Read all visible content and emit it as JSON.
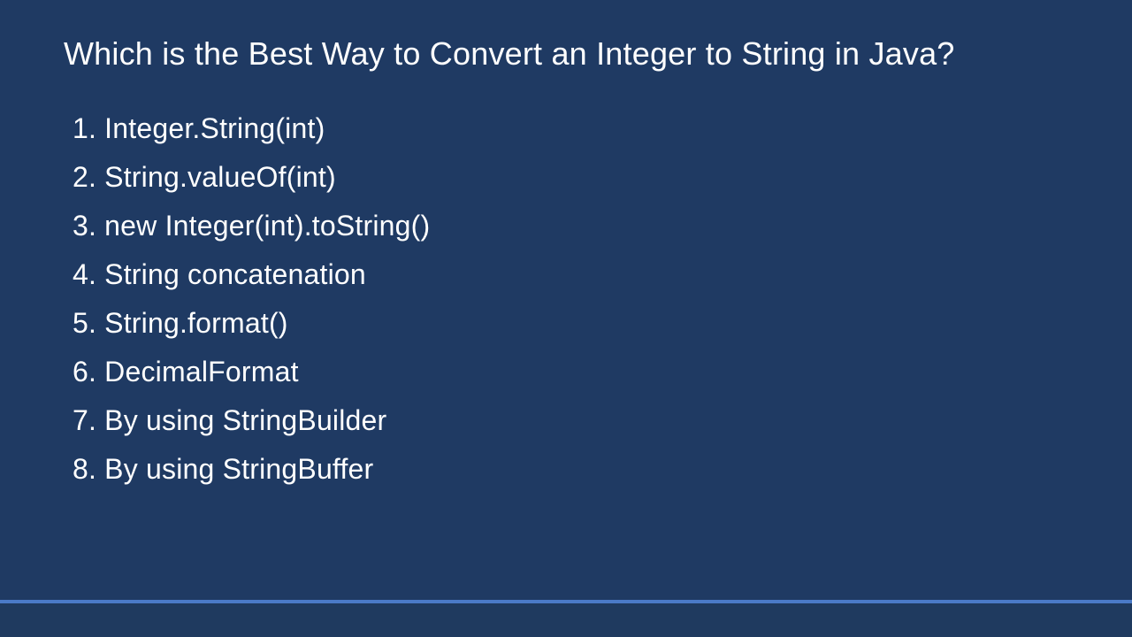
{
  "title": "Which is the Best Way to Convert an Integer to String in Java?",
  "items": [
    "1. Integer.String(int)",
    "2. String.valueOf(int)",
    "3. new Integer(int).toString()",
    "4. String concatenation",
    "5. String.format()",
    "6. DecimalFormat",
    "7. By using StringBuilder",
    "8. By using StringBuffer"
  ]
}
